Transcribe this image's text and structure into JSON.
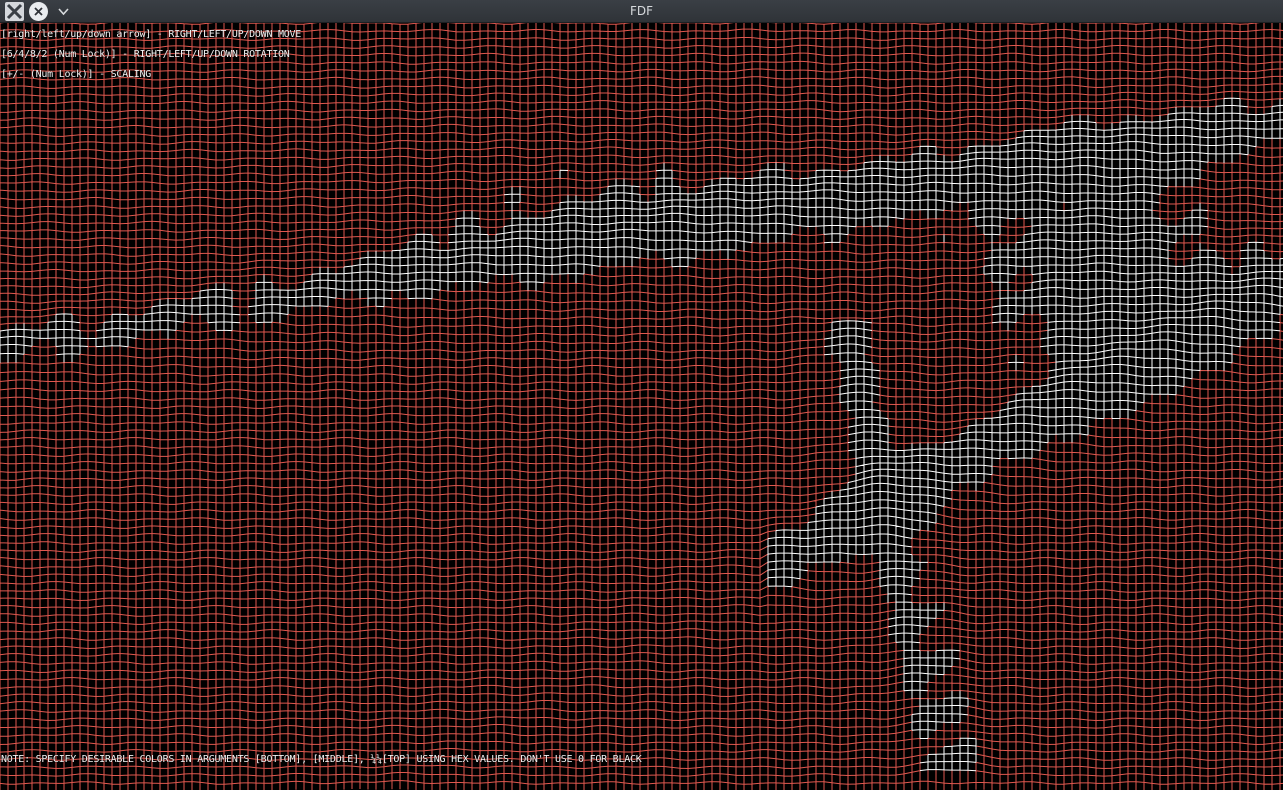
{
  "window": {
    "title": "FDF"
  },
  "titlebar": {
    "app_icon": "x11-app-icon",
    "close_icon": "close-icon",
    "menu_icon": "chevron-down-icon"
  },
  "help": {
    "move": "[right/left/up/down arrow] - RIGHT/LEFT/UP/DOWN MOVE",
    "rotate": "[6/4/8/2 (Num Lock)] - RIGHT/LEFT/UP/DOWN ROTATION",
    "scale": "[+/- (Num Lock)] - SCALING",
    "note": "NOTE: SPECIFY DESIRABLE COLORS IN ARGUMENTS [BOTTOM], [MIDDLE], ¼¼[TOP] USING HEX VALUES. DON'T USE 0 FOR BLACK"
  },
  "colors": {
    "background": "#000000",
    "mesh_low": "#e0584f",
    "mesh_high": "#ffffff",
    "help_text": "#f2f2f2"
  }
}
